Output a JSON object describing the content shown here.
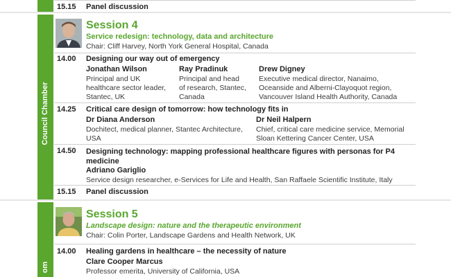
{
  "top_block": {
    "time": "15.15",
    "title": "Panel discussion"
  },
  "session4": {
    "room_label": "Council Chamber",
    "title": "Session 4",
    "subtitle": "Service redesign: technology, data and architecture",
    "chair": "Chair: Cliff Harvey, North York General Hospital, Canada",
    "photo_icon": "speaker-portrait",
    "talks": [
      {
        "time": "14.00",
        "title": "Designing our way out of emergency",
        "speakers": [
          {
            "name": "Jonathan Wilson",
            "desc": [
              "Principal and UK",
              "healthcare sector leader,",
              "Stantec, UK"
            ]
          },
          {
            "name": "Ray Pradinuk",
            "desc": [
              "Principal and head",
              "of research, Stantec,",
              "Canada"
            ]
          },
          {
            "name": "Drew Digney",
            "desc": [
              "Executive medical director, Nanaimo,",
              "Oceanside and Alberni-Clayoquot region,",
              "Vancouver Island Health Authority, Canada"
            ]
          }
        ]
      },
      {
        "time": "14.25",
        "title": "Critical care design of tomorrow: how technology fits in",
        "speakers": [
          {
            "name": "Dr Diana Anderson",
            "desc": [
              "Dochitect, medical planner, Stantec Architecture,",
              "USA"
            ]
          },
          {
            "name": "Dr Neil Halpern",
            "desc": [
              "Chief, critical care medicine service, Memorial",
              "Sloan Kettering Cancer Center, USA"
            ]
          }
        ]
      },
      {
        "time": "14.50",
        "title_lines": [
          "Designing technology: mapping professional healthcare figures with personas for P4",
          "medicine"
        ],
        "speakers": [
          {
            "name": "Adriano Gariglio",
            "desc": [
              "Service design researcher, e-Services for Life and Health, San Raffaele Scientific Institute, Italy"
            ]
          }
        ]
      },
      {
        "time": "15.15",
        "title": "Panel discussion"
      }
    ]
  },
  "session5": {
    "room_label": "om",
    "title": "Session 5",
    "subtitle": "Landscape design: nature and the therapeutic environment",
    "chair": "Chair: Colin Porter, Landscape Gardens and Health Network, UK",
    "photo_icon": "speaker-portrait",
    "talks": [
      {
        "time": "14.00",
        "title": "Healing gardens in healthcare – the necessity of nature",
        "speakers": [
          {
            "name": "Clare Cooper Marcus",
            "desc": [
              "Professor emerita, University of California, USA"
            ]
          }
        ]
      }
    ]
  },
  "colors": {
    "accent": "#5aa62f",
    "text": "#3a3a3a",
    "rule": "#cfcfcf"
  }
}
